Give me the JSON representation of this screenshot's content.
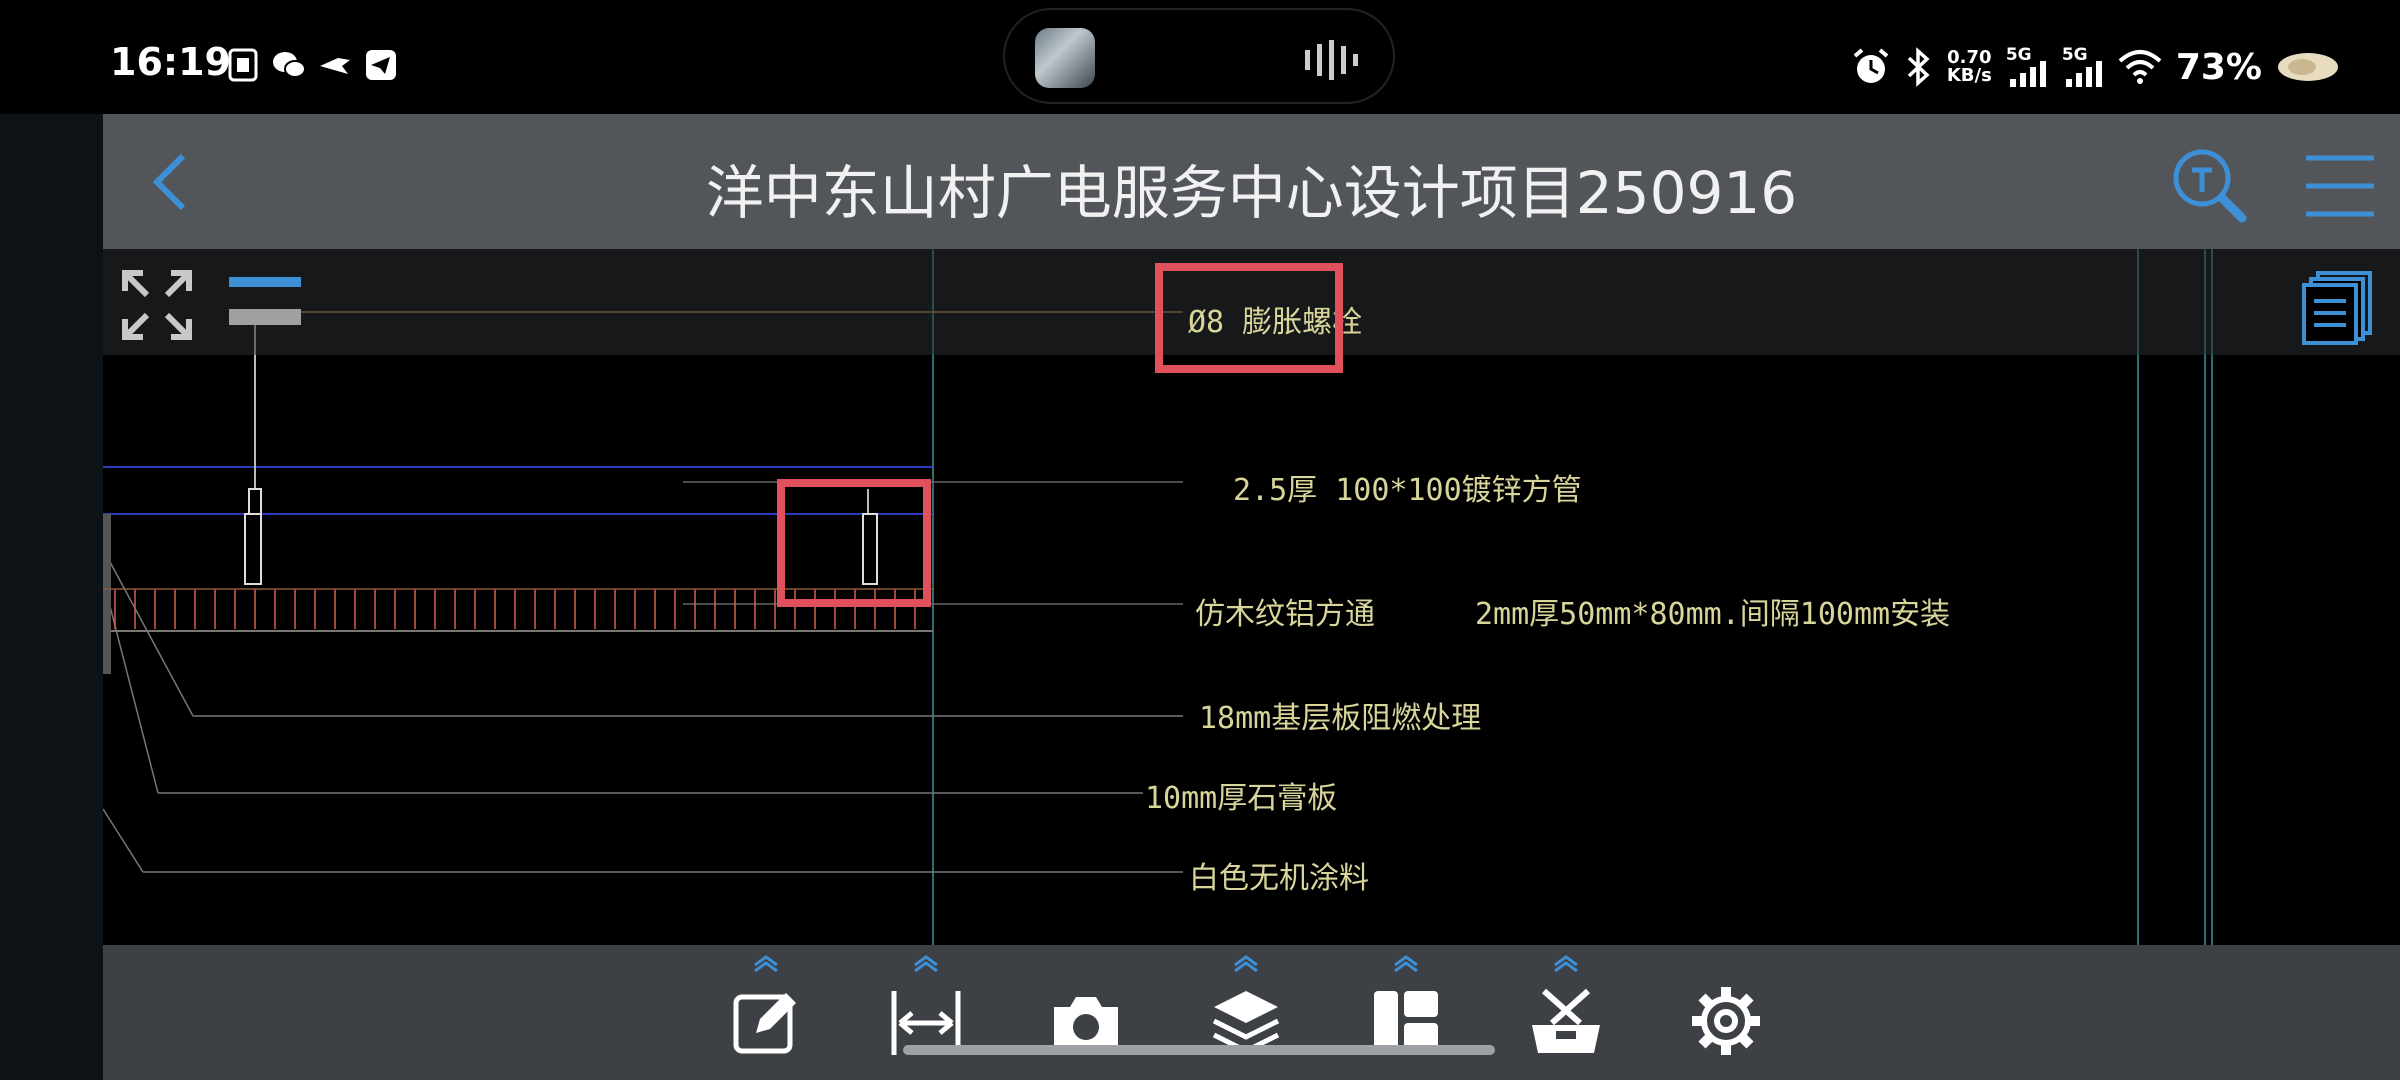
{
  "status_bar": {
    "time": "16:19",
    "net_speed_value": "0.70",
    "net_speed_unit": "KB/s",
    "sim1": "5G",
    "sim2": "5G",
    "battery": "73%",
    "icons": [
      "sim-card-icon",
      "wechat-icon",
      "pigeon-icon",
      "telegram-icon",
      "alarm-icon",
      "bluetooth-icon",
      "signal-icon",
      "wifi-icon",
      "battery-icon"
    ]
  },
  "header": {
    "title": "洋中东山村广电服务中心设计项目250916"
  },
  "drawing": {
    "labels": {
      "bolt": "Ø8 膨胀螺栓",
      "tube": "2.5厚 100*100镀锌方管",
      "aluminum": "仿木纹铝方通",
      "aluminum_spec": "2mm厚50mm*80mm.间隔100mm安装",
      "board": "18mm基层板阻燃处理",
      "gypsum": "10mm厚石膏板",
      "paint": "白色无机涂料"
    }
  },
  "toolbar": {
    "tools": [
      "edit",
      "measure",
      "camera",
      "layers",
      "layout",
      "toolbox",
      "settings"
    ]
  },
  "colors": {
    "accent": "#3d8fd6",
    "highlight": "#e1515c",
    "cad_text": "#d9d59a"
  }
}
